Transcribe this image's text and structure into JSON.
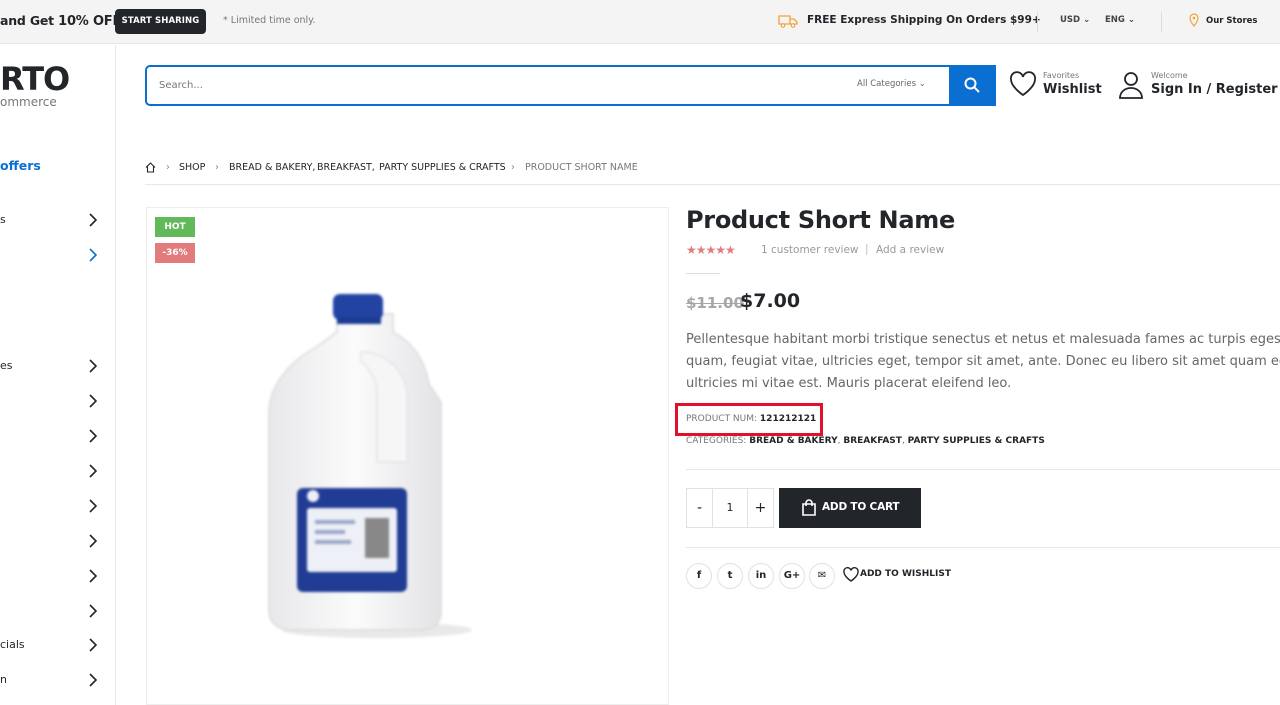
{
  "topbar": {
    "promo_prefix": "and Get ",
    "promo_highlight": "10% OFF",
    "share_label": "START SHARING",
    "limited": "* Limited time only.",
    "shipping": "FREE Express Shipping On Orders $99+",
    "currency": "USD",
    "language": "ENG",
    "stores": "Our Stores"
  },
  "sidebar": {
    "logo": "RTO",
    "logo_sub": "ommerce",
    "offers": "offers",
    "items": [
      "s",
      "",
      "es",
      "",
      "",
      "",
      "",
      "",
      "",
      "",
      "cials",
      "n"
    ]
  },
  "header": {
    "search_placeholder": "Search...",
    "categories": "All Categories",
    "fav_small": "Favorites",
    "fav_big": "Wishlist",
    "welcome_small": "Welcome",
    "welcome_big": "Sign In / Register"
  },
  "breadcrumb": {
    "items": [
      "SHOP",
      "BREAD & BAKERY,",
      "BREAKFAST,",
      "PARTY SUPPLIES & CRAFTS",
      "PRODUCT SHORT NAME"
    ]
  },
  "product": {
    "badge_hot": "HOT",
    "badge_sale": "-36%",
    "title": "Product Short Name",
    "stars": "★★★★★",
    "rating": 5,
    "review_count": "1 customer review",
    "separator": "|",
    "add_review": "Add a review",
    "old_price": "$11.00",
    "price": "$7.00",
    "description": [
      "Pellentesque habitant morbi tristique senectus et netus et malesuada fames ac turpis egestas. Vestibulum tortor",
      "quam, feugiat vitae, ultricies eget, tempor sit amet, ante. Donec eu libero sit amet quam egestas semper. Aenean",
      "ultricies mi vitae est. Mauris placerat eleifend leo."
    ],
    "num_label": "PRODUCT NUM:",
    "num_value": "121212121",
    "cat_label": "CATEGORIES:",
    "categories": [
      "BREAD & BAKERY",
      "BREAKFAST",
      "PARTY SUPPLIES & CRAFTS"
    ],
    "cat_sep": ", ",
    "qty_minus": "-",
    "qty_value": "1",
    "qty_plus": "+",
    "add_to_cart": "ADD TO CART",
    "social": [
      "f",
      "t",
      "in",
      "G+",
      "✉"
    ],
    "wishlist": "ADD TO WISHLIST"
  },
  "colors": {
    "accent": "#0b6fd2",
    "dark": "#222529",
    "hot": "#62b959",
    "sale": "#e27c7c",
    "highlight": "#e0112a"
  }
}
